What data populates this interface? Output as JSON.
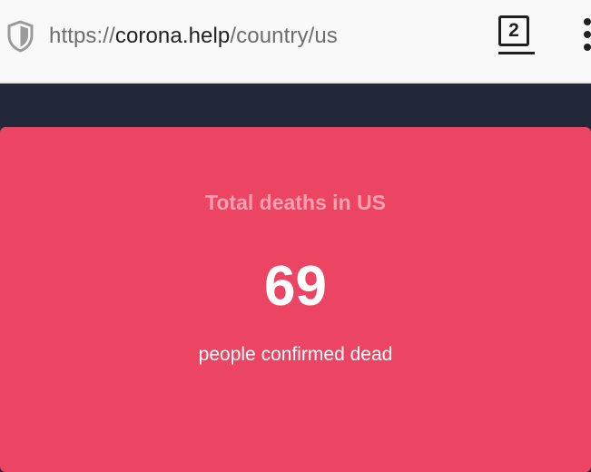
{
  "browser": {
    "url_prefix": "https://",
    "url_host": "corona.help",
    "url_path": "/country/us",
    "tab_count": "2",
    "icons": {
      "security": "shield-icon",
      "tabs": "tabs-counter-icon",
      "menu": "kebab-menu-icon"
    }
  },
  "card": {
    "title": "Total deaths in US",
    "value": "69",
    "subtitle": "people confirmed dead"
  },
  "colors": {
    "page_background": "#232838",
    "card_background": "#ec4563",
    "card_title": "#f7a0b0",
    "toolbar_background": "#f9f9f9"
  }
}
